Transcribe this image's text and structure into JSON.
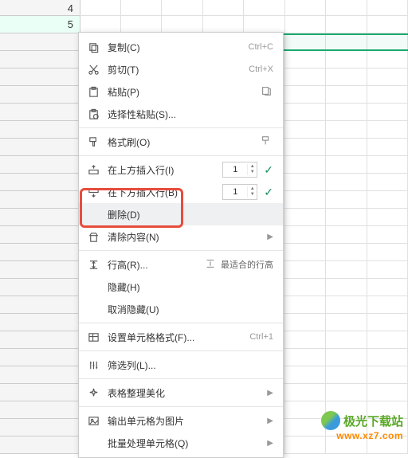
{
  "visible_row_headers": [
    "4",
    "5"
  ],
  "menu": {
    "copy": {
      "label": "复制(C)",
      "shortcut": "Ctrl+C"
    },
    "cut": {
      "label": "剪切(T)",
      "shortcut": "Ctrl+X"
    },
    "paste": {
      "label": "粘贴(P)"
    },
    "paste_special": {
      "label": "选择性粘贴(S)..."
    },
    "format_painter": {
      "label": "格式刷(O)"
    },
    "insert_above": {
      "label": "在上方插入行(I)",
      "count": "1"
    },
    "insert_below": {
      "label": "在下方插入行(B)",
      "count": "1"
    },
    "delete": {
      "label": "删除(D)"
    },
    "clear": {
      "label": "清除内容(N)"
    },
    "row_height": {
      "label": "行高(R)..."
    },
    "best_fit": {
      "label": "最适合的行高"
    },
    "hide": {
      "label": "隐藏(H)"
    },
    "unhide": {
      "label": "取消隐藏(U)"
    },
    "format_cells": {
      "label": "设置单元格格式(F)...",
      "shortcut": "Ctrl+1"
    },
    "filter": {
      "label": "筛选列(L)..."
    },
    "table_beautify": {
      "label": "表格整理美化"
    },
    "export_image": {
      "label": "输出单元格为图片"
    },
    "batch": {
      "label": "批量处理单元格(Q)"
    }
  },
  "watermark": {
    "name": "极光下载站",
    "url": "www.xz7.com"
  }
}
